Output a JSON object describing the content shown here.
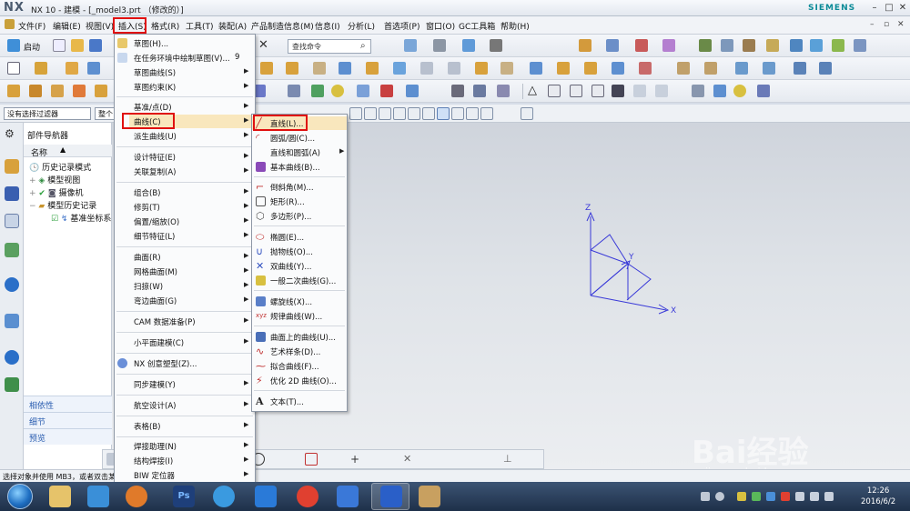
{
  "titlebar": {
    "logo": "NX",
    "title": "NX 10 - 建模 - [_model3.prt （修改的）]",
    "brand": "SIEMENS"
  },
  "menubar": {
    "items": [
      "文件(F)",
      "编辑(E)",
      "视图(V)",
      "插入(S)",
      "格式(R)",
      "工具(T)",
      "装配(A)",
      "产品制造信息(M)",
      "信息(I)",
      "分析(L)",
      "首选项(P)",
      "窗口(O)",
      "GC工具箱",
      "帮助(H)"
    ]
  },
  "toolbar": {
    "start_label": "启动",
    "search_placeholder": "查找命令"
  },
  "selection": {
    "filter": "没有选择过滤器",
    "scope": "整个"
  },
  "navigator": {
    "title": "部件导航器",
    "column_name": "名称",
    "rows": [
      "历史记录模式",
      "模型视图",
      "摄像机",
      "模型历史记录",
      "基准坐标系"
    ],
    "lower_panels": [
      "相依性",
      "细节",
      "预览"
    ]
  },
  "insert_menu": {
    "items": [
      {
        "label": "草图(H)...",
        "shortcut": ""
      },
      {
        "label": "在任务环境中绘制草图(V)...",
        "shortcut": "9"
      },
      {
        "label": "草图曲线(S)",
        "shortcut": ""
      },
      {
        "label": "草图约束(K)",
        "shortcut": ""
      },
      {
        "label": "基准/点(D)",
        "shortcut": ""
      },
      {
        "label": "曲线(C)",
        "shortcut": ""
      },
      {
        "label": "派生曲线(U)",
        "shortcut": ""
      },
      {
        "label": "设计特征(E)",
        "shortcut": ""
      },
      {
        "label": "关联复制(A)",
        "shortcut": ""
      },
      {
        "label": "组合(B)",
        "shortcut": ""
      },
      {
        "label": "修剪(T)",
        "shortcut": ""
      },
      {
        "label": "偏置/缩放(O)",
        "shortcut": ""
      },
      {
        "label": "细节特征(L)",
        "shortcut": ""
      },
      {
        "label": "曲面(R)",
        "shortcut": ""
      },
      {
        "label": "网格曲面(M)",
        "shortcut": ""
      },
      {
        "label": "扫掠(W)",
        "shortcut": ""
      },
      {
        "label": "弯边曲面(G)",
        "shortcut": ""
      },
      {
        "label": "CAM 数据准备(P)",
        "shortcut": ""
      },
      {
        "label": "小平面建模(C)",
        "shortcut": ""
      },
      {
        "label": "NX 创意塑型(Z)...",
        "shortcut": ""
      },
      {
        "label": "同步建模(Y)",
        "shortcut": ""
      },
      {
        "label": "航空设计(A)",
        "shortcut": ""
      },
      {
        "label": "表格(B)",
        "shortcut": ""
      },
      {
        "label": "焊接助理(N)",
        "shortcut": ""
      },
      {
        "label": "结构焊接(I)",
        "shortcut": ""
      },
      {
        "label": "BIW 定位器",
        "shortcut": ""
      }
    ]
  },
  "curve_menu": {
    "items": [
      "直线(L)...",
      "圆弧/圆(C)...",
      "直线和圆弧(A)",
      "基本曲线(B)...",
      "倒斜角(M)...",
      "矩形(R)...",
      "多边形(P)...",
      "椭圆(E)...",
      "抛物线(O)...",
      "双曲线(Y)...",
      "一般二次曲线(G)...",
      "螺旋线(X)...",
      "规律曲线(W)...",
      "曲面上的曲线(U)...",
      "艺术样条(D)...",
      "拟合曲线(F)...",
      "优化 2D 曲线(O)...",
      "文本(T)..."
    ]
  },
  "viewport": {
    "axis_x": "X",
    "axis_y": "Y",
    "axis_z": "Z"
  },
  "status": {
    "text": "选择对象并使用 MB3，或者双击某"
  },
  "taskbar": {
    "time": "12:26",
    "date": "2016/6/2"
  },
  "watermark": {
    "main": "Bai经验",
    "sub": "jingyan.baidu.com"
  },
  "colors": {
    "highlight": "#f9e7bd",
    "red_box": "#e01010",
    "csys_blue": "#3a3ad8"
  }
}
